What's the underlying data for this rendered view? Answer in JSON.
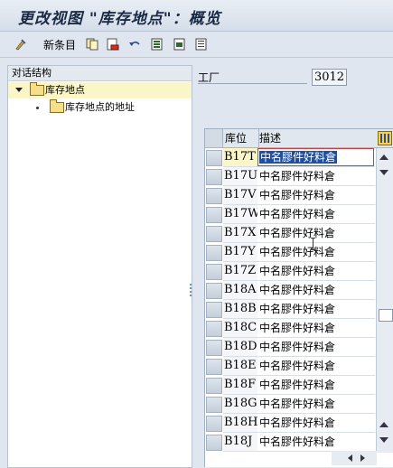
{
  "window": {
    "title": "更改视图 \"库存地点\"：概览"
  },
  "toolbar": {
    "new_entries_label": "新条目",
    "icons": [
      "edit-icon",
      "new-entries",
      "copy-icon",
      "delete-icon",
      "undo-icon",
      "select-all-icon",
      "select-block-icon",
      "deselect-all-icon"
    ]
  },
  "tree": {
    "header": "对话结构",
    "items": [
      {
        "label": "库存地点",
        "selected": true,
        "expanded": true
      },
      {
        "label": "库存地点的地址",
        "selected": false
      }
    ]
  },
  "form": {
    "plant_label": "工厂",
    "plant_value": "3012"
  },
  "table": {
    "columns": [
      "库位",
      "描述"
    ],
    "rows": [
      {
        "loc": "B17T",
        "desc": "中名膠件好料倉"
      },
      {
        "loc": "B17U",
        "desc": "中名膠件好料倉"
      },
      {
        "loc": "B17V",
        "desc": "中名膠件好料倉"
      },
      {
        "loc": "B17W",
        "desc": "中名膠件好料倉"
      },
      {
        "loc": "B17X",
        "desc": "中名膠件好料倉"
      },
      {
        "loc": "B17Y",
        "desc": "中名膠件好料倉"
      },
      {
        "loc": "B17Z",
        "desc": "中名膠件好料倉"
      },
      {
        "loc": "B18A",
        "desc": "中名膠件好料倉"
      },
      {
        "loc": "B18B",
        "desc": "中名膠件好料倉"
      },
      {
        "loc": "B18C",
        "desc": "中名膠件好料倉"
      },
      {
        "loc": "B18D",
        "desc": "中名膠件好料倉"
      },
      {
        "loc": "B18E",
        "desc": "中名膠件好料倉"
      },
      {
        "loc": "B18F",
        "desc": "中名膠件好料倉"
      },
      {
        "loc": "B18G",
        "desc": "中名膠件好料倉"
      },
      {
        "loc": "B18H",
        "desc": "中名膠件好料倉"
      },
      {
        "loc": "B18J",
        "desc": "中名膠件好料倉"
      }
    ]
  },
  "colors": {
    "selection": "#1f4ea7",
    "active_row": "#fbf6c7",
    "background": "#dfe6ef"
  }
}
